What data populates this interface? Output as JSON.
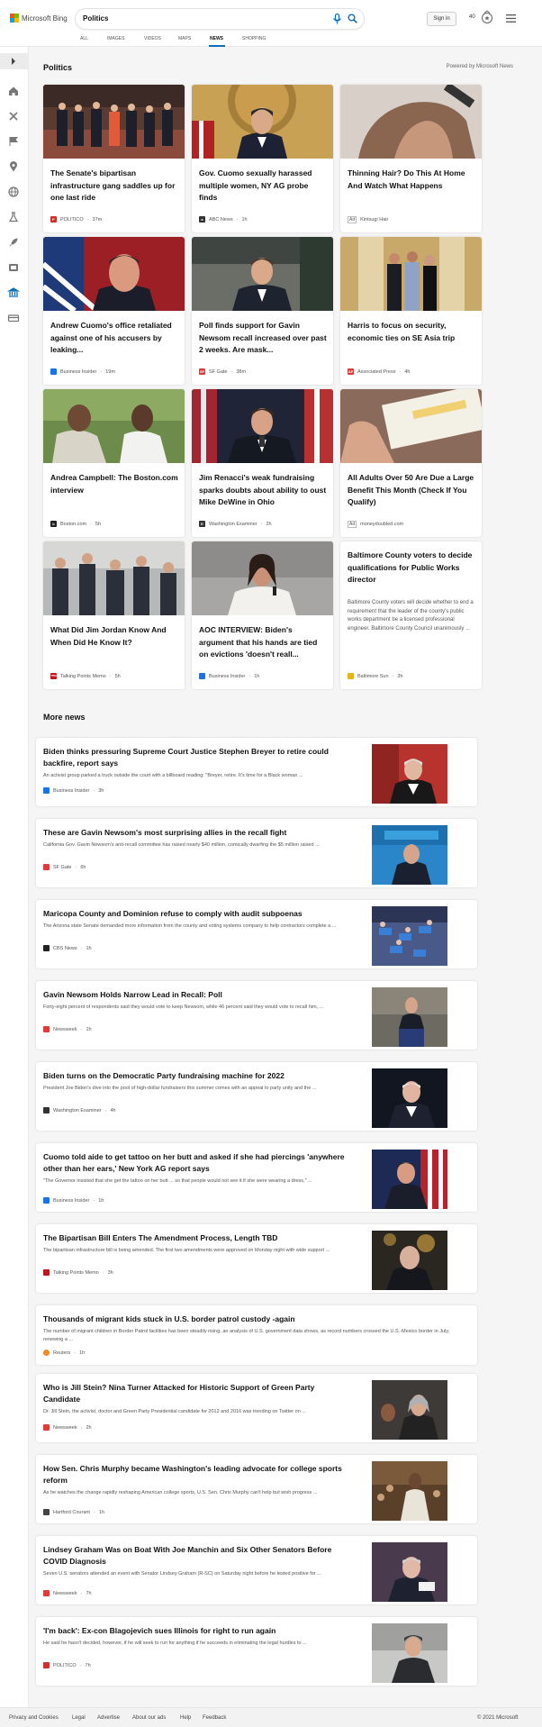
{
  "header": {
    "logo_text": "Microsoft Bing",
    "search_value": "Politics",
    "signin_label": "Sign in",
    "rewards_points": "40",
    "tabs": [
      {
        "label": "ALL"
      },
      {
        "label": "IMAGES"
      },
      {
        "label": "VIDEOS"
      },
      {
        "label": "MAPS"
      },
      {
        "label": "NEWS"
      },
      {
        "label": "SHOPPING"
      }
    ],
    "active_tab": "NEWS"
  },
  "top_section": {
    "title": "Politics",
    "powered_by": "Powered by Microsoft News",
    "cards": [
      {
        "title": "The Senate's bipartisan infrastructure gang saddles up for one last ride",
        "source": "POLITICO",
        "time": "37m",
        "logo_color": "#d0302b",
        "logo_letter": "P"
      },
      {
        "title": "Gov. Cuomo sexually harassed multiple women, NY AG probe finds",
        "source": "ABC News",
        "time": "1h",
        "logo_color": "#333333",
        "logo_letter": "a"
      },
      {
        "title": "Thinning Hair? Do This At Home And Watch What Happens",
        "source": "Kintsugi Hair",
        "time": "",
        "ad_label": "Ad"
      },
      {
        "title": "Andrew Cuomo's office retaliated against one of his accusers by leaking...",
        "source": "Business Insider",
        "time": "19m",
        "logo_color": "#1a73e8",
        "logo_letter": ""
      },
      {
        "title": "Poll finds support for Gavin Newsom recall increased over past 2 weeks. Are mask...",
        "source": "SF Gate",
        "time": "38m",
        "logo_color": "#e03a3a",
        "logo_letter": "SF"
      },
      {
        "title": "Harris to focus on security, economic ties on SE Asia trip",
        "source": "Associated Press",
        "time": "4h",
        "logo_color": "#e03a3a",
        "logo_letter": "AP"
      },
      {
        "title": "Andrea Campbell: The Boston.com interview",
        "source": "Boston.com",
        "time": "5h",
        "logo_color": "#222222",
        "logo_letter": "b"
      },
      {
        "title": "Jim Renacci's weak fundraising sparks doubts about ability to oust Mike DeWine in Ohio",
        "source": "Washington Examiner",
        "time": "2h",
        "logo_color": "#333333",
        "logo_letter": "E"
      },
      {
        "title": "All Adults Over 50 Are Due a Large Benefit This Month (Check If You Qualify)",
        "source": "moneydoubled.com",
        "time": "",
        "ad_label": "Ad"
      },
      {
        "title": "What Did Jim Jordan Know And When Did He Know It?",
        "source": "Talking Points Memo",
        "time": "5h",
        "logo_color": "#c0151c",
        "logo_letter": "TPM"
      },
      {
        "title": "AOC INTERVIEW: Biden's argument that his hands are tied on evictions 'doesn't reall...",
        "source": "Business Insider",
        "time": "1h",
        "logo_color": "#1a73e8",
        "logo_letter": ""
      },
      {
        "title": "Baltimore County voters to decide qualifications for Public Works director",
        "description": "Baltimore County voters will decide whether to end a requirement that the leader of the county's public works department be a licensed professional engineer. Baltimore County Council unanimously ...",
        "source": "Baltimore Sun",
        "time": "3h",
        "logo_color": "#e8b21a",
        "logo_letter": ""
      }
    ]
  },
  "more_news": {
    "title": "More news",
    "items": [
      {
        "title": "Biden thinks pressuring Supreme Court Justice Stephen Breyer to retire could backfire, report says",
        "description": "An activist group parked a truck outside the court with a billboard reading: \"Breyer, retire. It's time for a Black woman ...",
        "source": "Business Insider",
        "time": "3h",
        "logo_color": "#1a73e8"
      },
      {
        "title": "These are Gavin Newsom's most surprising allies in the recall fight",
        "description": "California Gov. Gavin Newsom's anti-recall committee has raised nearly $40 million, comically dwarfing the $5 million raised ...",
        "source": "SF Gate",
        "time": "6h",
        "logo_color": "#e03a3a"
      },
      {
        "title": "Maricopa County and Dominion refuse to comply with audit subpoenas",
        "description": "The Arizona state Senate demanded more information from the county and voting systems company to help contractors complete a ...",
        "source": "CBS News",
        "time": "1h",
        "logo_color": "#222222"
      },
      {
        "title": "Gavin Newsom Holds Narrow Lead in Recall: Poll",
        "description": "Forty-eight percent of respondents said they would vote to keep Newsom, while 46 percent said they would vote to recall him, ...",
        "source": "Newsweek",
        "time": "1h",
        "logo_color": "#e03a3a"
      },
      {
        "title": "Biden turns on the Democratic Party fundraising machine for 2022",
        "description": "President Joe Biden's dive into the pool of high-dollar fundraisers this summer comes with an appeal to party unity and the ...",
        "source": "Washington Examiner",
        "time": "4h",
        "logo_color": "#333333"
      },
      {
        "title": "Cuomo told aide to get tattoo on her butt and asked if she had piercings 'anywhere other than her ears,' New York AG report says",
        "description": "\"The Governor insisted that she get the tattoo on her butt ... so that people would not see it if she were wearing a dress,\" ...",
        "source": "Business Insider",
        "time": "1h",
        "logo_color": "#1a73e8"
      },
      {
        "title": "The Bipartisan Bill Enters The Amendment Process, Length TBD",
        "description": "The bipartisan infrastructure bill is being amended. The first two amendments were approved on Monday night with wide support ...",
        "source": "Talking Points Memo",
        "time": "3h",
        "logo_color": "#c0151c"
      },
      {
        "title": "Thousands of migrant kids stuck in U.S. border patrol custody -again",
        "description": "The number of migrant children in Border Patrol facilities has been steadily rising, an analysis of U.S. government data shows, as record numbers crossed the U.S.-Mexico border in July, renewing a ...",
        "source": "Reuters",
        "time": "1h",
        "logo_color": "#f08a24"
      },
      {
        "title": "Who is Jill Stein? Nina Turner Attacked for Historic Support of Green Party Candidate",
        "description": "Dr. Jill Stein, the activist, doctor and Green Party Presidential candidate for 2012 and 2016 was trending on Twitter on ...",
        "source": "Newsweek",
        "time": "2h",
        "logo_color": "#e03a3a"
      },
      {
        "title": "How Sen. Chris Murphy became Washington's leading advocate for college sports reform",
        "description": "As he watches the change rapidly reshaping American college sports, U.S. Sen. Chris Murphy can't help but wish progress ...",
        "source": "Hartford Courant",
        "time": "1h",
        "logo_color": "#444444"
      },
      {
        "title": "Lindsey Graham Was on Boat With Joe Manchin and Six Other Senators Before COVID Diagnosis",
        "description": "Seven U.S. senators attended an event with Senator Lindsey Graham (R-SC) on Saturday night before he tested positive for ...",
        "source": "Newsweek",
        "time": "7h",
        "logo_color": "#e03a3a"
      },
      {
        "title": "'I'm back': Ex-con Blagojevich sues Illinois for right to run again",
        "description": "He said he hasn't decided, however, if he will seek to run for anything if he succeeds in eliminating the legal hurdles to ...",
        "source": "POLITICO",
        "time": "7h",
        "logo_color": "#d0302b"
      }
    ]
  },
  "footer": {
    "links": [
      "Privacy and Cookies",
      "Legal",
      "Advertise",
      "About our ads",
      "Help",
      "Feedback"
    ],
    "copyright": "© 2021 Microsoft"
  }
}
